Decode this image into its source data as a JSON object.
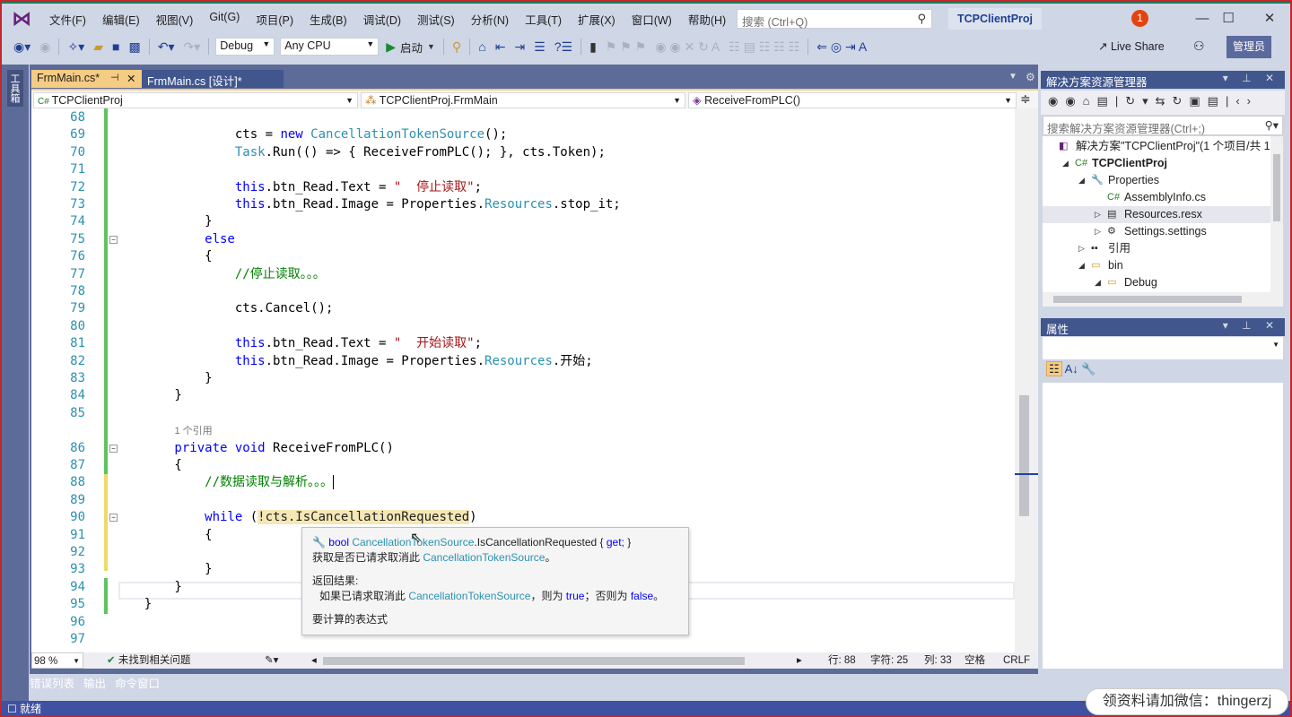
{
  "app": {
    "logo": "visual-studio-logo",
    "project_title": "TCPClientProj",
    "notification_count": "1",
    "admin_label": "管理员",
    "live_share": "Live Share"
  },
  "menu": [
    "文件(F)",
    "编辑(E)",
    "视图(V)",
    "Git(G)",
    "项目(P)",
    "生成(B)",
    "调试(D)",
    "测试(S)",
    "分析(N)",
    "工具(T)",
    "扩展(X)",
    "窗口(W)",
    "帮助(H)"
  ],
  "search": {
    "placeholder": "搜索 (Ctrl+Q)"
  },
  "toolbar": {
    "config": "Debug",
    "platform": "Any CPU",
    "start": "启动"
  },
  "toolbox_label": "工具箱",
  "tabs": [
    {
      "label": "FrmMain.cs*",
      "active": true
    },
    {
      "label": "FrmMain.cs [设计]*",
      "active": false
    }
  ],
  "nav": {
    "project": "TCPClientProj",
    "class": "TCPClientProj.FrmMain",
    "member": "ReceiveFromPLC()"
  },
  "code": {
    "lines": [
      {
        "n": "68",
        "t": []
      },
      {
        "n": "69",
        "t": [
          [
            "pl",
            "                cts = "
          ],
          [
            "kw",
            "new"
          ],
          [
            "ty",
            " CancellationTokenSource"
          ],
          [
            "pl",
            "();"
          ]
        ]
      },
      {
        "n": "70",
        "t": [
          [
            "ty",
            "                Task"
          ],
          [
            "pl",
            ".Run(() => { ReceiveFromPLC(); }, cts.Token);"
          ]
        ]
      },
      {
        "n": "71",
        "t": []
      },
      {
        "n": "72",
        "t": [
          [
            "kw",
            "                this"
          ],
          [
            "pl",
            ".btn_Read.Text = "
          ],
          [
            "str",
            "\"  停止读取\""
          ],
          [
            "pl",
            ";"
          ]
        ]
      },
      {
        "n": "73",
        "t": [
          [
            "kw",
            "                this"
          ],
          [
            "pl",
            ".btn_Read.Image = Properties."
          ],
          [
            "ty",
            "Resources"
          ],
          [
            "pl",
            ".stop_it;"
          ]
        ]
      },
      {
        "n": "74",
        "t": [
          [
            "pl",
            "            }"
          ]
        ]
      },
      {
        "n": "75",
        "t": [
          [
            "kw",
            "            else"
          ]
        ]
      },
      {
        "n": "76",
        "t": [
          [
            "pl",
            "            {"
          ]
        ]
      },
      {
        "n": "77",
        "t": [
          [
            "cm",
            "                //停止读取。。。"
          ]
        ]
      },
      {
        "n": "78",
        "t": []
      },
      {
        "n": "79",
        "t": [
          [
            "pl",
            "                cts.Cancel();"
          ]
        ]
      },
      {
        "n": "80",
        "t": []
      },
      {
        "n": "81",
        "t": [
          [
            "kw",
            "                this"
          ],
          [
            "pl",
            ".btn_Read.Text = "
          ],
          [
            "str",
            "\"  开始读取\""
          ],
          [
            "pl",
            ";"
          ]
        ]
      },
      {
        "n": "82",
        "t": [
          [
            "kw",
            "                this"
          ],
          [
            "pl",
            ".btn_Read.Image = Properties."
          ],
          [
            "ty",
            "Resources"
          ],
          [
            "pl",
            ".开始;"
          ]
        ]
      },
      {
        "n": "83",
        "t": [
          [
            "pl",
            "            }"
          ]
        ]
      },
      {
        "n": "84",
        "t": [
          [
            "pl",
            "        }"
          ]
        ]
      },
      {
        "n": "85",
        "t": []
      },
      {
        "n": "",
        "t": [
          [
            "pl",
            "        "
          ],
          [
            "lens",
            "1 个引用"
          ]
        ]
      },
      {
        "n": "86",
        "t": [
          [
            "kw",
            "        private"
          ],
          [
            "pl",
            " "
          ],
          [
            "kw",
            "void"
          ],
          [
            "pl",
            " ReceiveFromPLC()"
          ]
        ]
      },
      {
        "n": "87",
        "t": [
          [
            "pl",
            "        {"
          ]
        ]
      },
      {
        "n": "88",
        "t": [
          [
            "cm",
            "            //数据读取与解析。。。"
          ]
        ]
      },
      {
        "n": "89",
        "t": []
      },
      {
        "n": "90",
        "t": [
          [
            "kw",
            "            while"
          ],
          [
            "pl",
            " ("
          ],
          [
            "hl",
            "!cts.IsCancellationRequested"
          ],
          [
            "pl",
            ")"
          ]
        ]
      },
      {
        "n": "91",
        "t": [
          [
            "pl",
            "            {"
          ]
        ]
      },
      {
        "n": "92",
        "t": []
      },
      {
        "n": "93",
        "t": [
          [
            "pl",
            "            }"
          ]
        ]
      },
      {
        "n": "94",
        "t": [
          [
            "pl",
            "        }"
          ]
        ]
      },
      {
        "n": "95",
        "t": [
          [
            "pl",
            "    }"
          ]
        ]
      },
      {
        "n": "96",
        "t": []
      },
      {
        "n": "97",
        "t": []
      }
    ]
  },
  "tooltip": {
    "type": "bool",
    "class": "CancellationTokenSource",
    "member": ".IsCancellationRequested { ",
    "get": "get;",
    "close": " }",
    "desc": "获取是否已请求取消此 ",
    "desc_class": "CancellationTokenSource",
    "desc_end": "。",
    "returns_label": "返回结果:",
    "ret1": "如果已请求取消此 ",
    "ret_class": "CancellationTokenSource",
    "ret2": "，则为 ",
    "ret_true": "true",
    "ret3": "；否则为 ",
    "ret_false": "false",
    "ret4": "。",
    "footer": "要计算的表达式"
  },
  "editor_status": {
    "zoom": "98 %",
    "issues": "未找到相关问题",
    "line": "行: 88",
    "char": "字符: 25",
    "col": "列: 33",
    "spaces": "空格",
    "eol": "CRLF"
  },
  "bottom_tabs": [
    "错误列表",
    "输出",
    "命令窗口"
  ],
  "status": "就绪",
  "watermark": "领资料请加微信：thingerzj",
  "solution": {
    "title": "解决方案资源管理器",
    "search_placeholder": "搜索解决方案资源管理器(Ctrl+;)",
    "items": [
      {
        "label": "解决方案\"TCPClientProj\"(1 个项目/共 1 个)",
        "icon": "solution-icon",
        "expander": ""
      },
      {
        "label": "TCPClientProj",
        "icon": "csharp-project-icon",
        "expander": "◢"
      },
      {
        "label": "Properties",
        "icon": "wrench-icon",
        "expander": "◢"
      },
      {
        "label": "AssemblyInfo.cs",
        "icon": "csharp-file-icon",
        "expander": ""
      },
      {
        "label": "Resources.resx",
        "icon": "resource-file-icon",
        "expander": "▷"
      },
      {
        "label": "Settings.settings",
        "icon": "gear-icon",
        "expander": "▷"
      },
      {
        "label": "引用",
        "icon": "references-icon",
        "expander": "▷"
      },
      {
        "label": "bin",
        "icon": "folder-icon",
        "expander": "◢"
      },
      {
        "label": "Debug",
        "icon": "folder-icon",
        "expander": "◢"
      }
    ]
  },
  "properties": {
    "title": "属性"
  }
}
